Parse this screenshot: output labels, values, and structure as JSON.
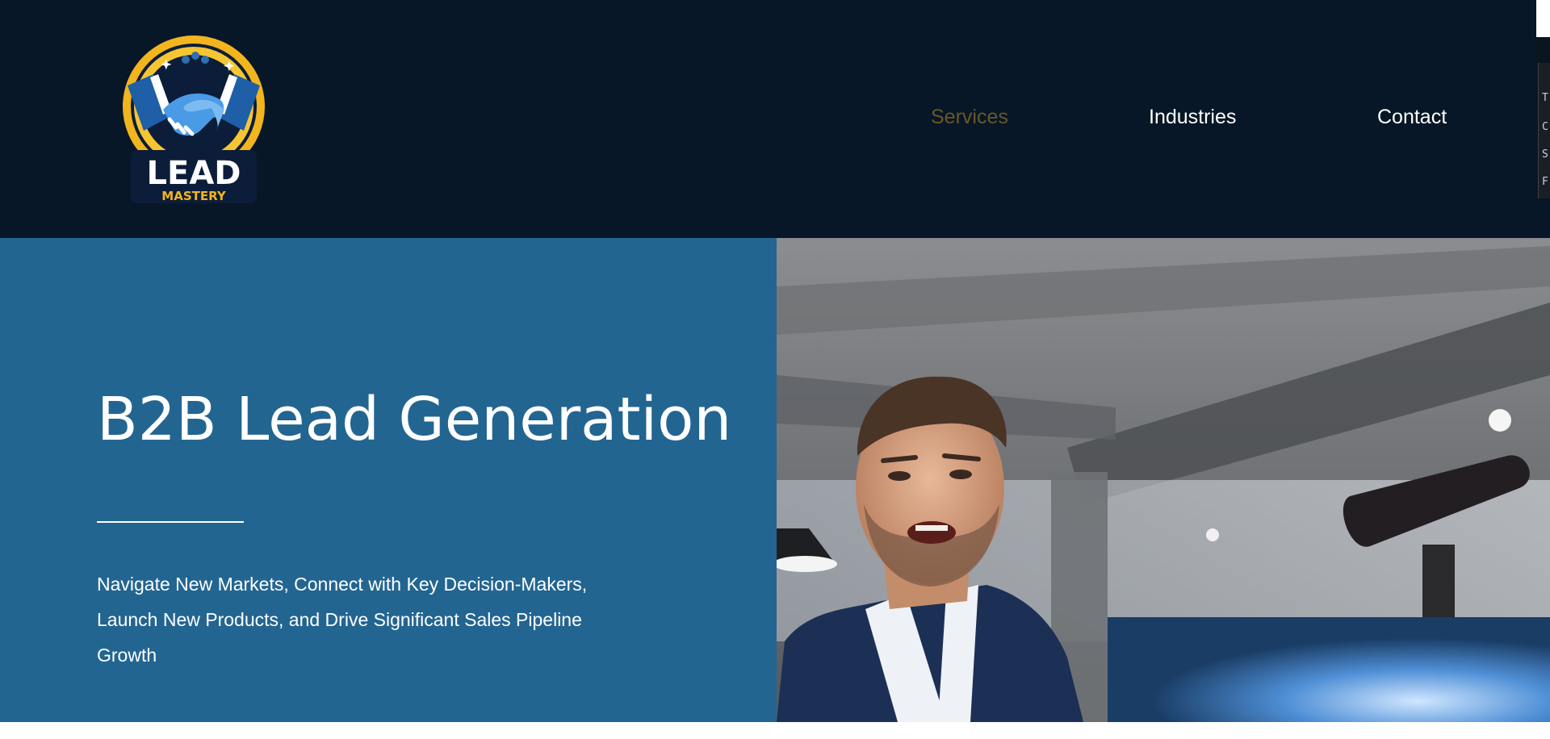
{
  "header": {
    "logo": {
      "word": "LEAD",
      "tagline": "MASTERY",
      "icon": "handshake-icon",
      "colors": {
        "ring": "#f2b51e",
        "navy": "#0c1d3a",
        "blue": "#3f8fdc",
        "gold": "#f2b51e"
      }
    },
    "nav": {
      "items": [
        {
          "label": "Services",
          "active": true
        },
        {
          "label": "Industries",
          "active": false
        },
        {
          "label": "Contact",
          "active": false
        }
      ]
    },
    "background_color": "#071727",
    "active_color": "#6a5627"
  },
  "edge_widget": {
    "chars": [
      "T",
      "C",
      "S",
      "F"
    ]
  },
  "hero": {
    "title": "B2B Lead Generation",
    "subtitle": "Navigate New Markets, Connect with Key Decision-Makers, Launch New Products, and Drive Significant Sales Pipeline Growth",
    "panel_color": "#236591",
    "image": "man-speaking-photo"
  }
}
